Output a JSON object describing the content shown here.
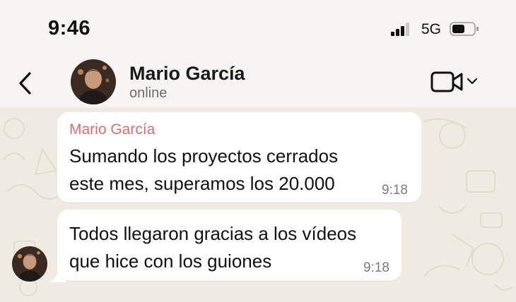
{
  "status": {
    "time": "9:46",
    "network": "5G"
  },
  "header": {
    "contact_name": "Mario García",
    "contact_status": "online"
  },
  "messages": [
    {
      "sender": "Mario García",
      "text_lines": [
        "Sumando los proyectos cerrados",
        "este mes, superamos los 20.000"
      ],
      "time": "9:18"
    },
    {
      "text_lines": [
        "Todos llegaron gracias a los vídeos",
        "que hice con los guiones"
      ],
      "time": "9:18"
    }
  ],
  "colors": {
    "sender_name": "#e06c6c",
    "chat_background": "#efeae2",
    "bubble": "#ffffff"
  },
  "icons": [
    "signal-icon",
    "battery-icon",
    "back-arrow-icon",
    "video-call-icon",
    "chevron-down-icon"
  ]
}
